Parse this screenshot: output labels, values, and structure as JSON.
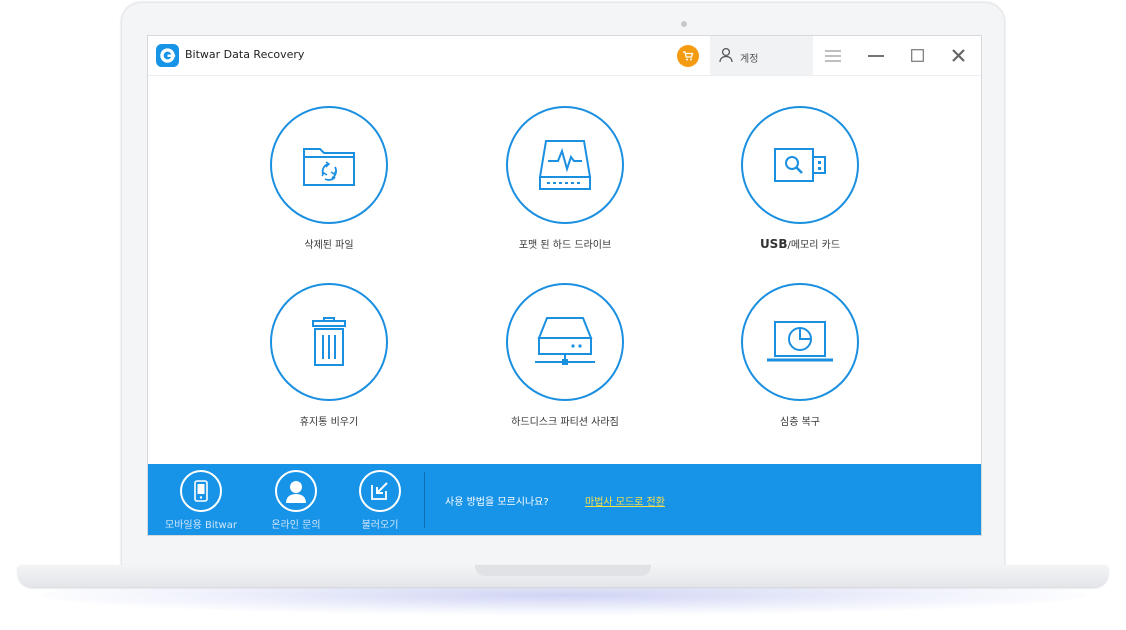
{
  "app": {
    "title": "Bitwar Data Recovery",
    "account_label": "계정"
  },
  "items": [
    {
      "label": "삭제된 파일"
    },
    {
      "label": "포맷 된 하드 드라이브"
    },
    {
      "label_strong": "USB",
      "label_rest": "/메모리 카드"
    },
    {
      "label": "휴지통 비우기"
    },
    {
      "label": "하드디스크 파티션 사라짐"
    },
    {
      "label": "심층 복구"
    }
  ],
  "footer": {
    "mobile_label": "모바일용 Bitwar",
    "online_label": "온라인 문의",
    "load_label": "불러오기",
    "help_text": "사용 방법을 모르시나요?",
    "wizard_link": "마법사 모드로 전환"
  },
  "colors": {
    "accent": "#1793e8",
    "cart": "#f39c12",
    "link": "#f5e04a"
  }
}
